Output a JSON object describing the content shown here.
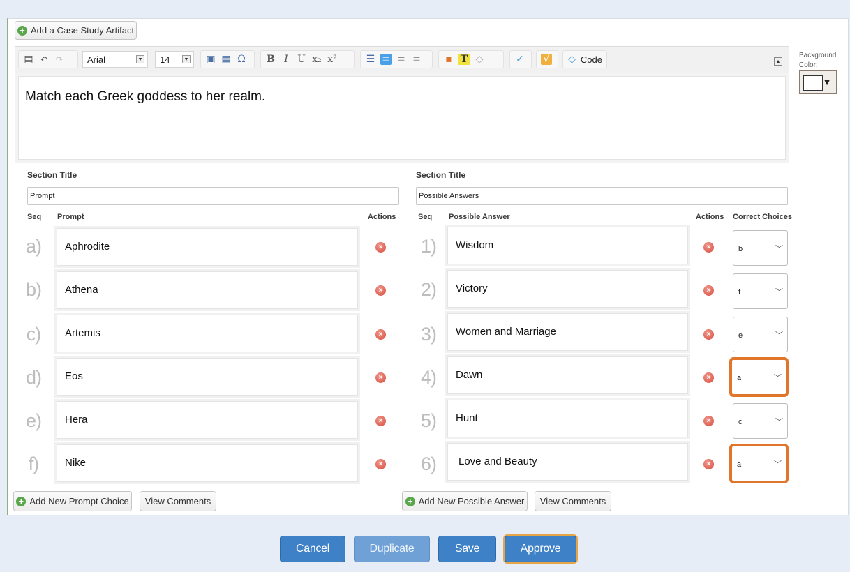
{
  "toolbar": {
    "add_artifact": "Add a Case Study Artifact",
    "font": "Arial",
    "size": "14",
    "code_label": "Code"
  },
  "editor": {
    "content": "Match each Greek goddess to her realm."
  },
  "background": {
    "label": "Background Color:",
    "color": "#ffffff"
  },
  "left": {
    "section_title_label": "Section Title",
    "section_title_value": "Prompt",
    "col_seq": "Seq",
    "col_main": "Prompt",
    "col_actions": "Actions",
    "items": [
      {
        "seq": "a)",
        "text": "Aphrodite"
      },
      {
        "seq": "b)",
        "text": "Athena"
      },
      {
        "seq": "c)",
        "text": "Artemis"
      },
      {
        "seq": "d)",
        "text": "Eos"
      },
      {
        "seq": "e)",
        "text": "Hera"
      },
      {
        "seq": "f)",
        "text": "Nike"
      }
    ],
    "add_button": "Add New Prompt Choice",
    "comments_button": "View Comments"
  },
  "right": {
    "section_title_label": "Section Title",
    "section_title_value": "Possible Answers",
    "col_seq": "Seq",
    "col_main": "Possible Answer",
    "col_actions": "Actions",
    "col_choices": "Correct Choices",
    "items": [
      {
        "seq": "1)",
        "text": "Wisdom",
        "choice": "b"
      },
      {
        "seq": "2)",
        "text": "Victory",
        "choice": "f"
      },
      {
        "seq": "3)",
        "text": "Women and Marriage",
        "choice": "e"
      },
      {
        "seq": "4)",
        "text": "Dawn",
        "choice": "a"
      },
      {
        "seq": "5)",
        "text": "Hunt",
        "choice": "c"
      },
      {
        "seq": "6)",
        "text": "Love and Beauty",
        "choice": "a"
      }
    ],
    "add_button": "Add New Possible Answer",
    "comments_button": "View Comments"
  },
  "actions": {
    "cancel": "Cancel",
    "duplicate": "Duplicate",
    "save": "Save",
    "approve": "Approve"
  },
  "colors": {
    "primary": "#3e81c6",
    "highlight": "#e0762b",
    "delete": "#d5493b",
    "add": "#5aa64a"
  }
}
